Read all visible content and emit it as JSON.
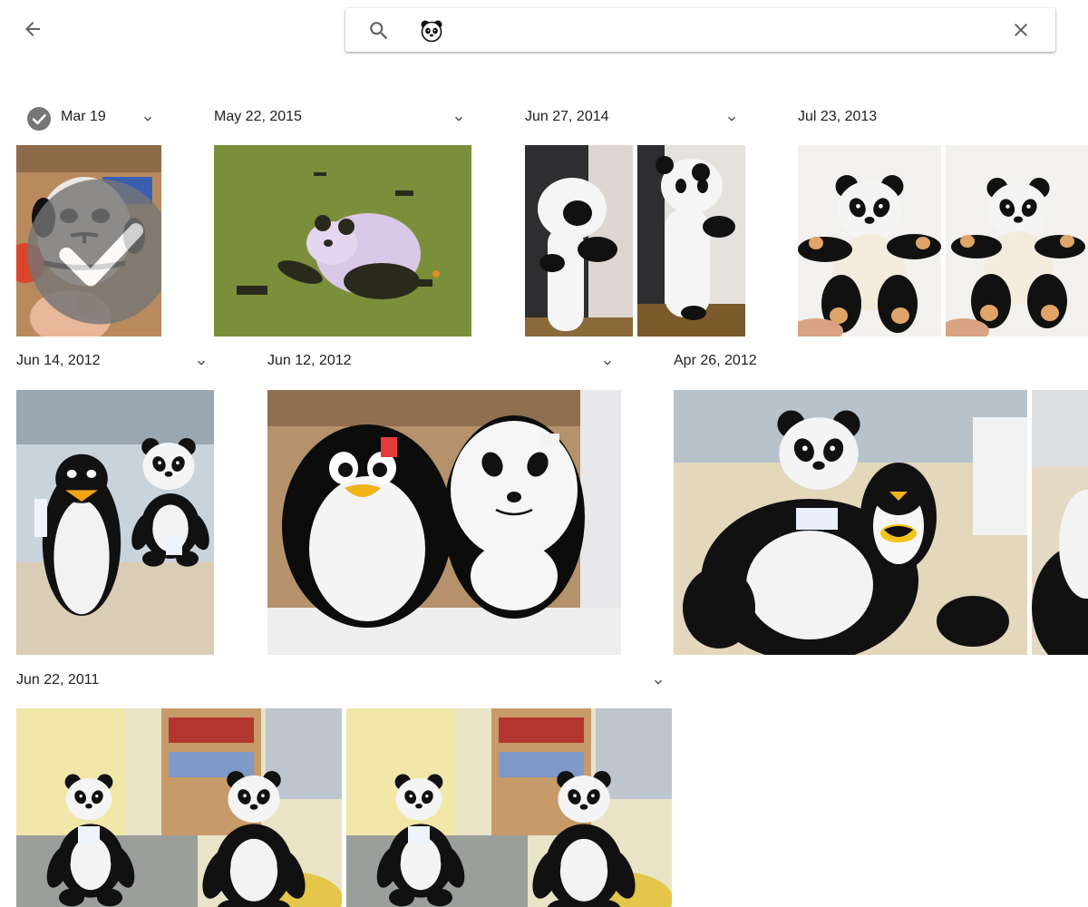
{
  "search": {
    "query_chip": "panda-emoji-icon"
  },
  "icons": {
    "back": "arrow-back-icon",
    "search": "search-icon",
    "clear": "close-icon",
    "expand": "chevron-down-icon",
    "select": "check-circle-icon"
  },
  "colors": {
    "icon_gray": "#616161",
    "check_gray": "#757575",
    "text": "#212121"
  },
  "sections": [
    {
      "date": "Mar 19",
      "selected": true,
      "photos": [
        "plush-panda-held-in-hand"
      ]
    },
    {
      "date": "May 22, 2015",
      "photos": [
        "panda-tshirt-tanks-helicopters"
      ]
    },
    {
      "date": "Jun 27, 2014",
      "photos": [
        "hanging-panda-plush-1",
        "hanging-panda-plush-2"
      ]
    },
    {
      "date": "Jul 23, 2013",
      "photos": [
        "panda-teddy-held-1",
        "panda-teddy-held-2"
      ]
    },
    {
      "date": "Jun 14, 2012",
      "photos": [
        "penguin-and-panda-plush-on-couch"
      ]
    },
    {
      "date": "Jun 12, 2012",
      "photos": [
        "penguin-and-panda-kids-suitcases"
      ]
    },
    {
      "date": "Apr 26, 2012",
      "photos": [
        "big-panda-with-batman-penguin",
        "panda-plush-cropped"
      ]
    },
    {
      "date": "Jun 22, 2011",
      "photos": [
        "two-panda-plush-in-office-1",
        "two-panda-plush-in-office-2"
      ]
    }
  ]
}
